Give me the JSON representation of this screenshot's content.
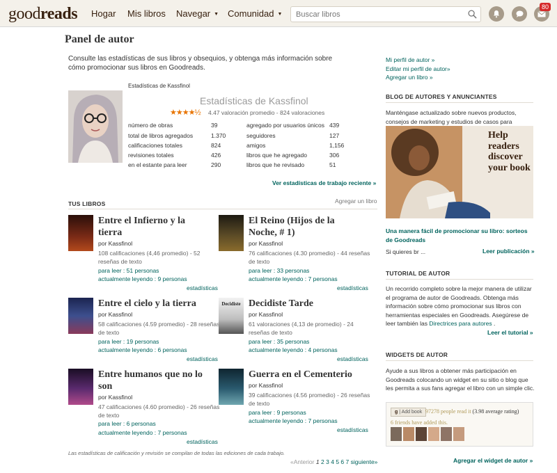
{
  "header": {
    "logo_light": "good",
    "logo_bold": "reads",
    "nav": [
      "Hogar",
      "Mis libros",
      "Navegar",
      "Comunidad"
    ],
    "search_placeholder": "Buscar libros",
    "notification_count": "80"
  },
  "page": {
    "title": "Panel de autor",
    "intro": "Consulte las estadísticas de sus libros y obsequios, y obtenga más información sobre cómo promocionar sus libros en Goodreads."
  },
  "right_links": [
    "Mi perfil de autor »",
    "Editar mi perfil de autor»",
    "Agregar un libro »"
  ],
  "stats": {
    "small_label": "Estadísticas de Kassfinol",
    "title": "Estadísticas de Kassfinol",
    "rating": 4.47,
    "rating_text": "4.47 valoración promedio - 824 valoraciones",
    "left": [
      {
        "label": "número de obras",
        "value": "39"
      },
      {
        "label": "total de libros agregados",
        "value": "1.370"
      },
      {
        "label": "calificaciones totales",
        "value": "824"
      },
      {
        "label": "revisiones totales",
        "value": "426"
      },
      {
        "label": "en el estante para leer",
        "value": "290"
      }
    ],
    "right": [
      {
        "label": "agregado por usuarios únicos",
        "value": "439"
      },
      {
        "label": "seguidores",
        "value": "127"
      },
      {
        "label": "amigos",
        "value": "1,156"
      },
      {
        "label": "libros que he agregado",
        "value": "306"
      },
      {
        "label": "libros que he revisado",
        "value": "51"
      }
    ],
    "recent_link": "Ver estadísticas de trabajo reciente »"
  },
  "books_section": {
    "heading": "TUS LIBROS",
    "add_link": "Agregar un libro",
    "stats_label": "estadísticas",
    "books": [
      {
        "title_lines": [
          "Entre el Infierno y la",
          "tierra"
        ],
        "by": "por Kassfinol",
        "meta_lines": [
          "108 calificaciones (4,46 promedio) - 52",
          "reseñas de texto"
        ],
        "to_read": "para leer : 51 personas",
        "reading": "actualmente leyendo : 9 personas",
        "cover_color": "#5a1f14"
      },
      {
        "title_lines": [
          "El Reino (Hijos de la",
          "Noche, # 1)"
        ],
        "by": "por Kassfinol",
        "meta_lines": [
          "76 calificaciones (4.30 promedio) - 44 reseñas",
          "de texto"
        ],
        "to_read": "para leer : 33 personas",
        "reading": "actualmente leyendo : 7 personas",
        "cover_color": "#3b3320"
      },
      {
        "title_lines": [
          "Entre el cielo y la tierra"
        ],
        "by": "por Kassfinol",
        "meta_lines": [
          "58 calificaciones (4.59 promedio) - 28 reseñas",
          "de texto"
        ],
        "to_read": "para leer : 19 personas",
        "reading": "actualmente leyendo : 6 personas",
        "cover_color": "#2d3a6b"
      },
      {
        "title_lines": [
          "Decidiste Tarde"
        ],
        "by": "por Kassfinol",
        "meta_lines": [
          "61 valoraciones (4,13 de promedio) - 24",
          "reseñas de texto"
        ],
        "to_read": "para leer : 35 personas",
        "reading": "actualmente leyendo : 4 personas",
        "cover_color": "#d9d9d9",
        "cover_text": "Decidiste"
      },
      {
        "title_lines": [
          "Entre humanos que no lo",
          "son"
        ],
        "by": "por Kassfinol",
        "meta_lines": [
          "47 calificaciones (4.60 promedio) - 26 reseñas",
          "de texto"
        ],
        "to_read": "para leer : 6 personas",
        "reading": "actualmente leyendo : 7 personas",
        "cover_color": "#3a1f4a"
      },
      {
        "title_lines": [
          "Guerra en el Cementerio"
        ],
        "by": "por Kassfinol",
        "meta_lines": [
          "39 calificaciones (4.56 promedio) - 26 reseñas",
          "de texto"
        ],
        "to_read": "para leer : 9 personas",
        "reading": "actualmente leyendo : 7 personas",
        "cover_color": "#1e3a48"
      }
    ],
    "footnote": "Las estadísticas de calificación y revisión se compilan de todas las ediciones de cada trabajo.",
    "pager": {
      "prev": "«Anterior",
      "pages": [
        "1",
        "2",
        "3",
        "4",
        "5",
        "6",
        "7"
      ],
      "next": "siguiente»"
    }
  },
  "blog": {
    "heading": "BLOG DE AUTORES Y ANUNCIANTES",
    "text": "Manténgase actualizado sobre nuevos productos, consejos de marketing y estudios de casos para autores.",
    "image_caption_lines": [
      "Help",
      "readers",
      "discover",
      "your book"
    ],
    "post_title_lines": [
      "Una manera fácil de promocionar su libro: sorteos",
      "de Goodreads"
    ],
    "teaser": "Si quieres br ...",
    "read_link": "Leer publicación »"
  },
  "tutorial": {
    "heading": "TUTORIAL DE AUTOR",
    "text_lines": [
      "Un recorrido completo sobre la mejor manera de utilizar",
      "el programa de autor de Goodreads. Obtenga más",
      "información sobre cómo promocionar sus libros con",
      "herramientas especiales en Goodreads. Asegúrese de"
    ],
    "last_line_text": "leer también las ",
    "last_line_link": "Directrices para autores",
    "last_line_end": " .",
    "read_link": "Leer el tutorial »"
  },
  "widgets": {
    "heading": "WIDGETS DE AUTOR",
    "text_lines": [
      "Ayude a sus libros a obtener más participación en",
      "Goodreads colocando un widget en su sitio o blog que",
      "les permita a sus fans agregar el libro con un simple clic."
    ],
    "add_book_label": "Add book",
    "people_read": "97278 people read it",
    "avg_rating": "(3.98 average rating)",
    "friends_added": "6 friends have added this.",
    "add_link": "Agregar el widget de autor »"
  }
}
